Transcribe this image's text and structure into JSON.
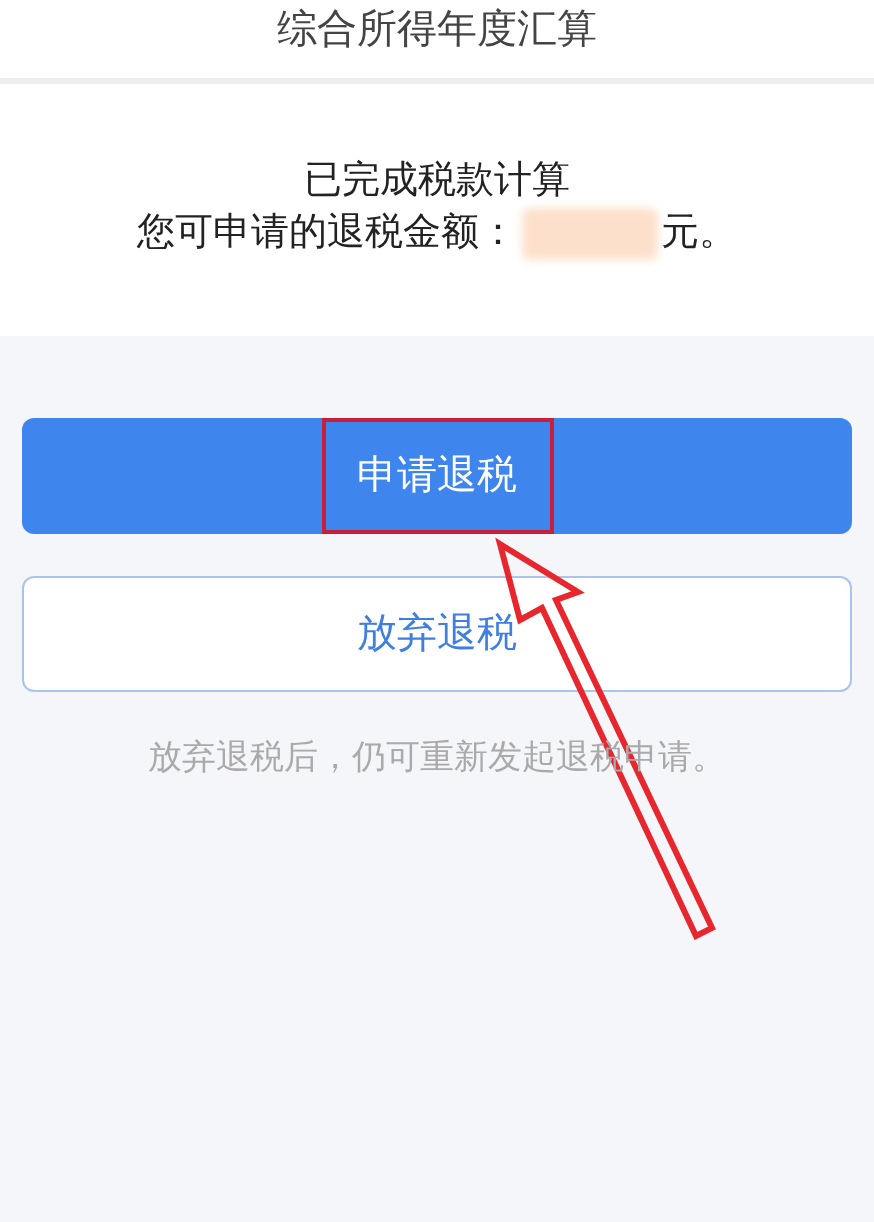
{
  "header": {
    "title": "综合所得年度汇算"
  },
  "result": {
    "status": "已完成税款计算",
    "amount_label": "您可申请的退税金额：",
    "amount_redacted": true,
    "amount_unit": "元。"
  },
  "buttons": [
    {
      "label": "申请退税",
      "kind": "primary",
      "highlighted": true
    },
    {
      "label": "放弃退税",
      "kind": "secondary",
      "highlighted": false
    }
  ],
  "hint": "放弃退税后，仍可重新发起退税申请。"
}
